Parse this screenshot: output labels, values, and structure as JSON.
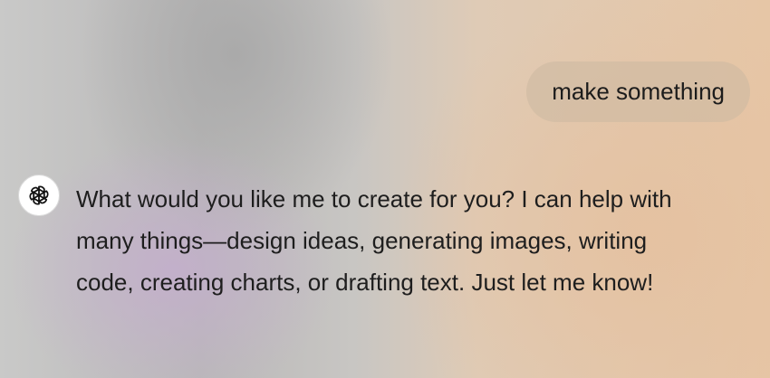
{
  "conversation": {
    "user_message": "make something",
    "assistant_message": "What would you like me to create for you? I can help with many things—design ideas, generating images, writing code, creating charts, or drafting text. Just let me know!",
    "assistant_avatar_icon": "openai-logo-icon"
  },
  "colors": {
    "user_bubble": "#cdb9a2",
    "text": "#1f1f1f",
    "avatar_background": "#ffffff"
  }
}
